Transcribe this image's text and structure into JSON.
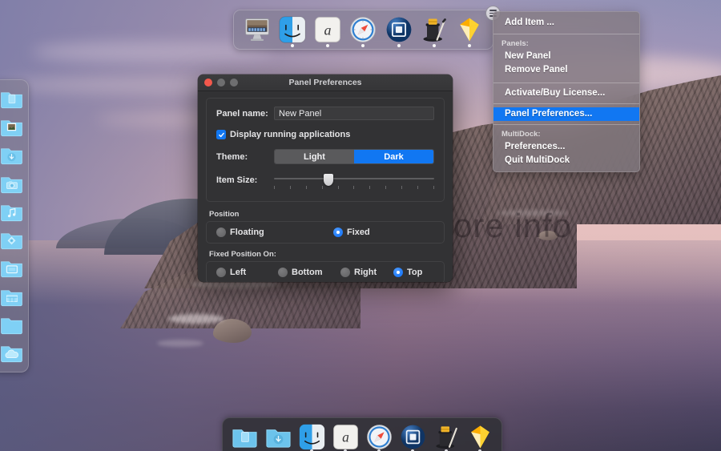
{
  "window": {
    "title": "Panel Preferences",
    "traffic_lights": [
      "close",
      "minimize",
      "zoom"
    ]
  },
  "prefs": {
    "panel_name_label": "Panel name:",
    "panel_name_value": "New Panel",
    "panel_name_placeholder": "New Panel",
    "display_running_label": "Display running applications",
    "display_running_checked": true,
    "theme_label": "Theme:",
    "theme_options": [
      "Light",
      "Dark"
    ],
    "theme_selected": "Dark",
    "item_size_label": "Item Size:",
    "item_size_percent": 33,
    "item_size_ticks": 11,
    "position_group_label": "Position",
    "position_options": [
      "Floating",
      "Fixed"
    ],
    "position_selected": "Fixed",
    "fixed_position_group_label": "Fixed Position On:",
    "fixed_position_options": [
      "Left",
      "Bottom",
      "Right",
      "Top"
    ],
    "fixed_position_selected": "Top"
  },
  "context_menu": {
    "items": [
      {
        "type": "item",
        "label": "Add Item ..."
      },
      {
        "type": "sep"
      },
      {
        "type": "head",
        "label": "Panels:"
      },
      {
        "type": "item",
        "label": "New Panel"
      },
      {
        "type": "item",
        "label": "Remove Panel"
      },
      {
        "type": "sep"
      },
      {
        "type": "item",
        "label": "Activate/Buy License..."
      },
      {
        "type": "sep"
      },
      {
        "type": "item",
        "label": "Panel Preferences...",
        "selected": true
      },
      {
        "type": "sep"
      },
      {
        "type": "head",
        "label": "MultiDock:"
      },
      {
        "type": "item",
        "label": "Preferences..."
      },
      {
        "type": "item",
        "label": "Quit MultiDock"
      }
    ]
  },
  "top_panel": {
    "menu_button_name": "hamburger-icon",
    "items": [
      {
        "icon": "imac-icon",
        "label": "iMac",
        "running": false
      },
      {
        "icon": "finder-icon",
        "label": "Finder",
        "running": true
      },
      {
        "icon": "font-book-icon",
        "label": "Font Book",
        "running": true
      },
      {
        "icon": "safari-icon",
        "label": "Safari",
        "running": true
      },
      {
        "icon": "mission-control-icon",
        "label": "Mission Control",
        "running": true
      },
      {
        "icon": "keynote-magician-icon",
        "label": "Keynote Magic Move",
        "running": true
      },
      {
        "icon": "sketch-icon",
        "label": "Sketch",
        "running": true
      }
    ]
  },
  "left_panel": {
    "items": [
      {
        "icon": "folder-documents-icon",
        "label": "Documents"
      },
      {
        "icon": "folder-pictures-icon",
        "label": "Pictures"
      },
      {
        "icon": "folder-downloads-icon",
        "label": "Downloads"
      },
      {
        "icon": "folder-camera-icon",
        "label": "Camera"
      },
      {
        "icon": "folder-music-icon",
        "label": "Music"
      },
      {
        "icon": "folder-public-icon",
        "label": "Public"
      },
      {
        "icon": "folder-desktop-icon",
        "label": "Desktop"
      },
      {
        "icon": "folder-sites-icon",
        "label": "Sites"
      },
      {
        "icon": "folder-plain-icon",
        "label": "Folder"
      },
      {
        "icon": "folder-cloud-icon",
        "label": "iCloud Drive"
      }
    ]
  },
  "bottom_dock": {
    "items": [
      {
        "icon": "folder-documents-icon",
        "label": "Documents",
        "running": false
      },
      {
        "icon": "folder-downloads-icon",
        "label": "Downloads",
        "running": false
      },
      {
        "icon": "finder-icon",
        "label": "Finder",
        "running": true
      },
      {
        "icon": "font-book-icon",
        "label": "Font Book",
        "running": true
      },
      {
        "icon": "safari-icon",
        "label": "Safari",
        "running": true
      },
      {
        "icon": "mission-control-icon",
        "label": "Mission Control",
        "running": true
      },
      {
        "icon": "keynote-magician-icon",
        "label": "Keynote Magic Move",
        "running": true
      },
      {
        "icon": "sketch-icon",
        "label": "Sketch",
        "running": true
      }
    ]
  },
  "watermark": {
    "text": "more info"
  },
  "colors": {
    "accent_blue": "#1177f2",
    "window_bg": "#323234",
    "menu_highlight": "#1177f2",
    "folder_blue": "#7fd0f5"
  }
}
